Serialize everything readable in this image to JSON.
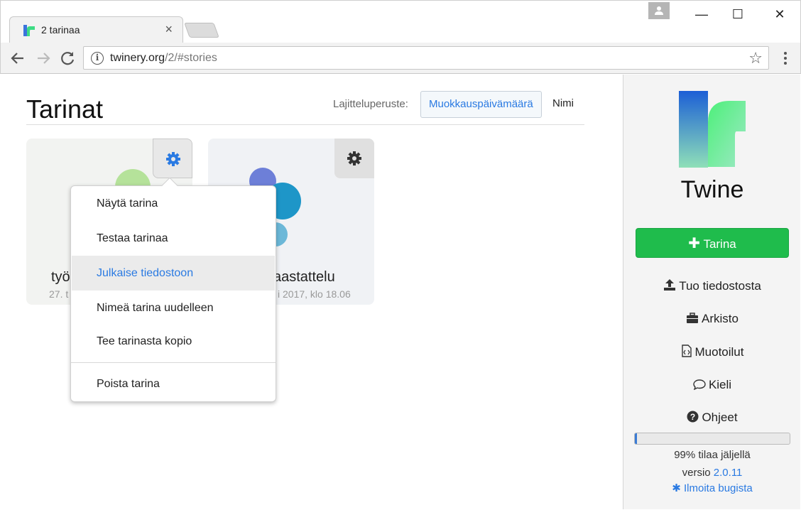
{
  "browser": {
    "tab_title": "2 tarinaa",
    "tab_close": "×",
    "url_host": "twinery.org",
    "url_path": "/2/#stories",
    "window_controls": {
      "minimize": "—",
      "maximize": "☐",
      "close": "✕"
    }
  },
  "header": {
    "title": "Tarinat",
    "sort_label": "Lajitteluperuste:",
    "sort_options": [
      {
        "label": "Muokkauspäivämäärä",
        "active": true
      },
      {
        "label": "Nimi",
        "active": false
      }
    ]
  },
  "stories": [
    {
      "name": "työ",
      "date": "27. t"
    },
    {
      "name": "aastattelu",
      "date": "i 2017, klo 18.06"
    }
  ],
  "story_menu": {
    "items": [
      {
        "label": "Näytä tarina"
      },
      {
        "label": "Testaa tarinaa"
      },
      {
        "label": "Julkaise tiedostoon"
      },
      {
        "label": "Nimeä tarina uudelleen"
      },
      {
        "label": "Tee tarinasta kopio"
      },
      {
        "label": "Poista tarina"
      }
    ],
    "highlighted_index": 2
  },
  "sidebar": {
    "app_name": "Twine",
    "new_story": "Tarina",
    "links": [
      {
        "label": "Tuo tiedostosta",
        "icon": "upload-icon"
      },
      {
        "label": "Arkisto",
        "icon": "briefcase-icon"
      },
      {
        "label": "Muotoilut",
        "icon": "code-file-icon"
      },
      {
        "label": "Kieli",
        "icon": "speech-bubble-icon"
      },
      {
        "label": "Ohjeet",
        "icon": "question-circle-icon"
      }
    ],
    "storage_text": "99% tilaa jäljellä",
    "storage_used_fraction": 0.01,
    "version_label": "versio",
    "version": "2.0.11",
    "report_bug": "Ilmoita bugista"
  },
  "colors": {
    "accent_blue": "#2a7ae2",
    "button_green": "#1fbc4c",
    "card1_circle": "#b5e29a",
    "card2_circles": [
      "#6d7fd8",
      "#1e96c8",
      "#6cb8d8"
    ]
  }
}
